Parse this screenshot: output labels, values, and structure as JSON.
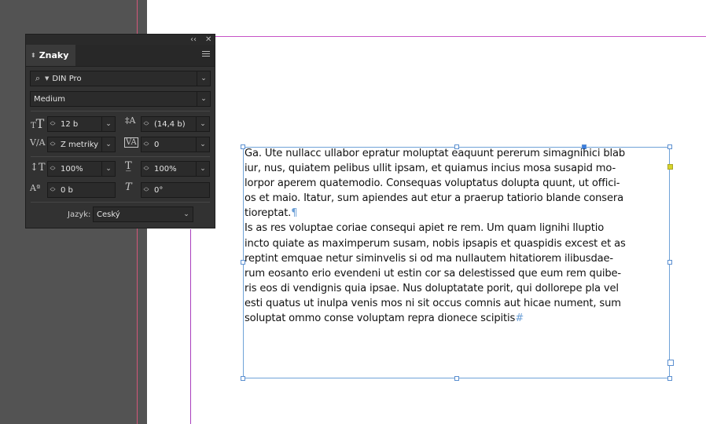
{
  "panel": {
    "title": "Znaky",
    "font_family": "DIN Pro",
    "font_style": "Medium",
    "font_size": "12 b",
    "leading": "(14,4 b)",
    "kerning": "Z metriky",
    "tracking": "0",
    "vertical_scale": "100%",
    "horizontal_scale": "100%",
    "baseline_shift": "0 b",
    "skew": "0°",
    "language_label": "Jazyk:",
    "language": "Český"
  },
  "text_frame": {
    "lines": [
      "Ga. Ute nullacc ullabor epratur moluptat eaquunt pererum simagnihici blab",
      "iur, nus, quiatem pelibus ullit ipsam, et quiamus incius mosa susapid mo-",
      "lorpor aperem quatemodio. Consequas voluptatus dolupta quunt, ut offici-",
      "os et maio. Itatur, sum apiendes aut etur a praerup tatiorio blande consera",
      "tioreptat.",
      "Is as res voluptae coriae consequi apiet re rem. Um quam lignihi lluptio",
      "incto quiate as maximperum susam, nobis ipsapis et quaspidis excest et as",
      "reptint emquae netur siminvelis si od ma nullautem hitatiorem ilibusdae-",
      "rum eosanto erio evendeni ut estin cor sa delestissed que eum rem quibe-",
      "ris eos di vendignis quia ipsae. Nus doluptatate porit, qui dollorepe pla vel",
      "esti quatus ut inulpa venis mos ni sit occus comnis aut hicae nument, sum",
      "soluptat ommo conse voluptam repra dionece scipitis"
    ],
    "paragraph_mark": "¶",
    "end_mark": "#"
  },
  "colors": {
    "selection": "#6fa2d8",
    "margin_guide": "#c653c6",
    "overset_handle": "#d7d42a"
  }
}
